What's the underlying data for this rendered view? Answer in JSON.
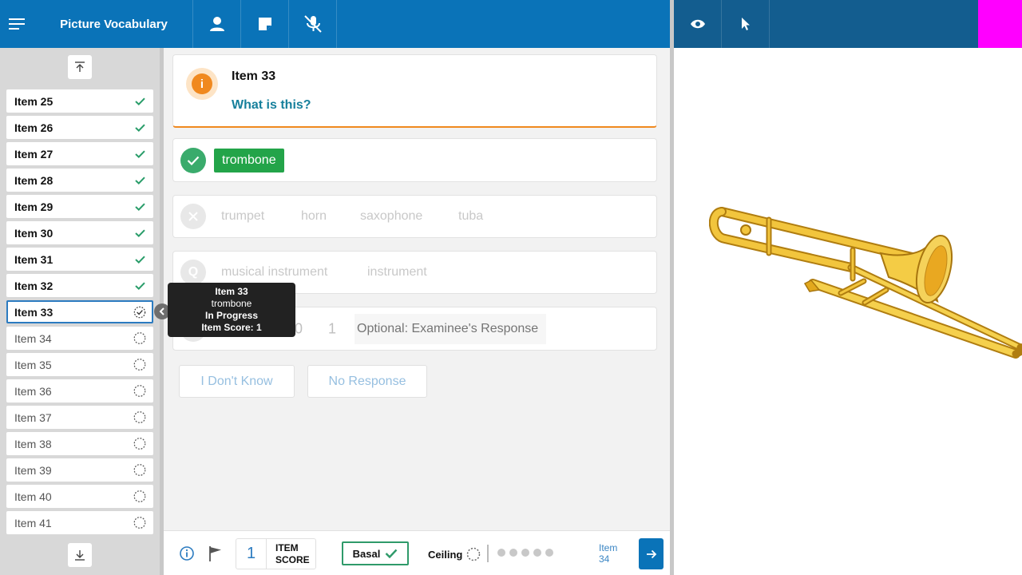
{
  "app": {
    "title": "Picture Vocabulary"
  },
  "topbar": {
    "icons": [
      "menu-icon",
      "user-icon",
      "note-icon",
      "mic-off-icon"
    ],
    "right_icons": [
      "eye-icon",
      "pointer-icon"
    ],
    "marker_color": "#ff00ff"
  },
  "sidebar": {
    "items": [
      {
        "label": "Item 25",
        "status": "done"
      },
      {
        "label": "Item 26",
        "status": "done"
      },
      {
        "label": "Item 27",
        "status": "done"
      },
      {
        "label": "Item 28",
        "status": "done"
      },
      {
        "label": "Item 29",
        "status": "done"
      },
      {
        "label": "Item 30",
        "status": "done"
      },
      {
        "label": "Item 31",
        "status": "done"
      },
      {
        "label": "Item 32",
        "status": "done"
      },
      {
        "label": "Item 33",
        "status": "current"
      },
      {
        "label": "Item 34",
        "status": "pending"
      },
      {
        "label": "Item 35",
        "status": "pending"
      },
      {
        "label": "Item 36",
        "status": "pending"
      },
      {
        "label": "Item 37",
        "status": "pending"
      },
      {
        "label": "Item 38",
        "status": "pending"
      },
      {
        "label": "Item 39",
        "status": "pending"
      },
      {
        "label": "Item 40",
        "status": "pending"
      },
      {
        "label": "Item 41",
        "status": "pending"
      }
    ]
  },
  "tooltip": {
    "title": "Item 33",
    "answer": "trombone",
    "status": "In Progress",
    "score": "Item Score: 1"
  },
  "question": {
    "item": "Item 33",
    "prompt": "What is this?"
  },
  "responses": {
    "correct": "trombone",
    "incorrect": [
      "trumpet",
      "horn",
      "saxophone",
      "tuba"
    ],
    "query": [
      "musical instrument",
      "instrument"
    ],
    "score_options": [
      "0",
      "1"
    ],
    "response_placeholder": "Optional: Examinee's Response"
  },
  "buttons": {
    "dont_know": "I Don't Know",
    "no_response": "No Response"
  },
  "footer": {
    "item_score": "1",
    "item_score_label_1": "ITEM",
    "item_score_label_2": "SCORE",
    "basal": "Basal",
    "ceiling": "Ceiling",
    "next_label_1": "Item",
    "next_label_2": "34"
  },
  "colors": {
    "primary": "#0a73b8",
    "accent": "#f0891f",
    "correct": "#23a449",
    "prompt": "#17809c"
  }
}
